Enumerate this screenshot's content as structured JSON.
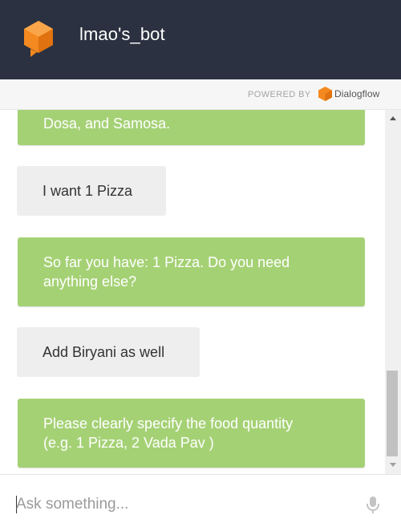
{
  "header": {
    "bot_name": "lmao's_bot"
  },
  "powered_by": {
    "label": "POWERED BY",
    "brand": "Dialogflow"
  },
  "messages": [
    {
      "sender": "bot",
      "lines": [
        "Dosa, and Samosa."
      ]
    },
    {
      "sender": "user",
      "lines": [
        "I want 1 Pizza"
      ]
    },
    {
      "sender": "bot",
      "lines": [
        "So far you have: 1 Pizza. Do you need",
        "anything else?"
      ]
    },
    {
      "sender": "user",
      "lines": [
        "Add Biryani as well"
      ]
    },
    {
      "sender": "bot",
      "lines": [
        "Please clearly specify the food quantity",
        "(e.g. 1 Pizza, 2 Vada Pav )"
      ]
    }
  ],
  "input": {
    "placeholder": "Ask something...",
    "value": ""
  },
  "colors": {
    "header_bg": "#2b3140",
    "bot_bubble": "#a5d175",
    "user_bubble": "#eeeeee",
    "brand_orange": "#f4891f"
  },
  "icons": [
    "bot-logo-icon",
    "dialogflow-icon",
    "microphone-icon",
    "scroll-up-icon",
    "scroll-down-icon"
  ]
}
